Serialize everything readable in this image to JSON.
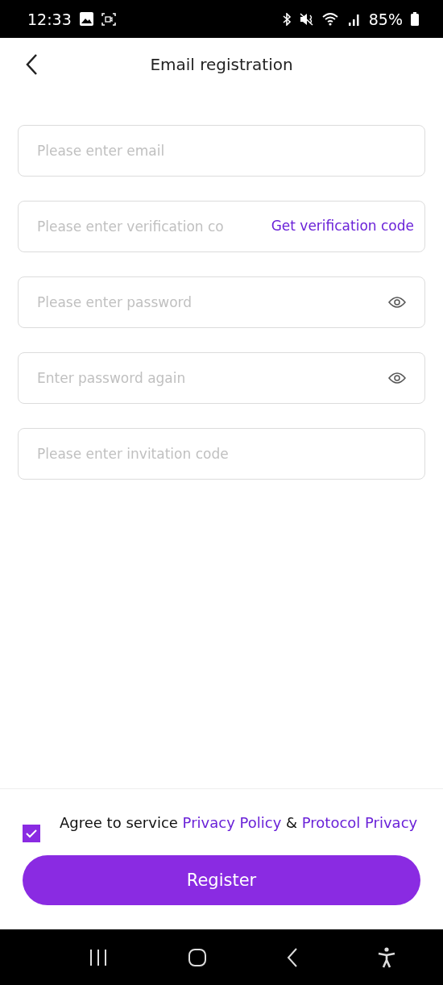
{
  "status_bar": {
    "time": "12:33",
    "battery": "85%"
  },
  "header": {
    "title": "Email registration"
  },
  "fields": [
    {
      "kind": "text",
      "placeholder": "Please enter email"
    },
    {
      "kind": "code",
      "placeholder": "Please enter verification co",
      "action": "Get verification code"
    },
    {
      "kind": "password",
      "placeholder": "Please enter password"
    },
    {
      "kind": "password",
      "placeholder": "Enter password again"
    },
    {
      "kind": "text",
      "placeholder": "Please enter invitation code"
    }
  ],
  "agreement": {
    "checked": true,
    "parts": [
      {
        "kind": "text",
        "text": "Agree to service "
      },
      {
        "kind": "link",
        "text": "Privacy Policy"
      },
      {
        "kind": "text",
        "text": " & "
      },
      {
        "kind": "link",
        "text": "Protocol Privacy"
      }
    ]
  },
  "register_button": "Register"
}
